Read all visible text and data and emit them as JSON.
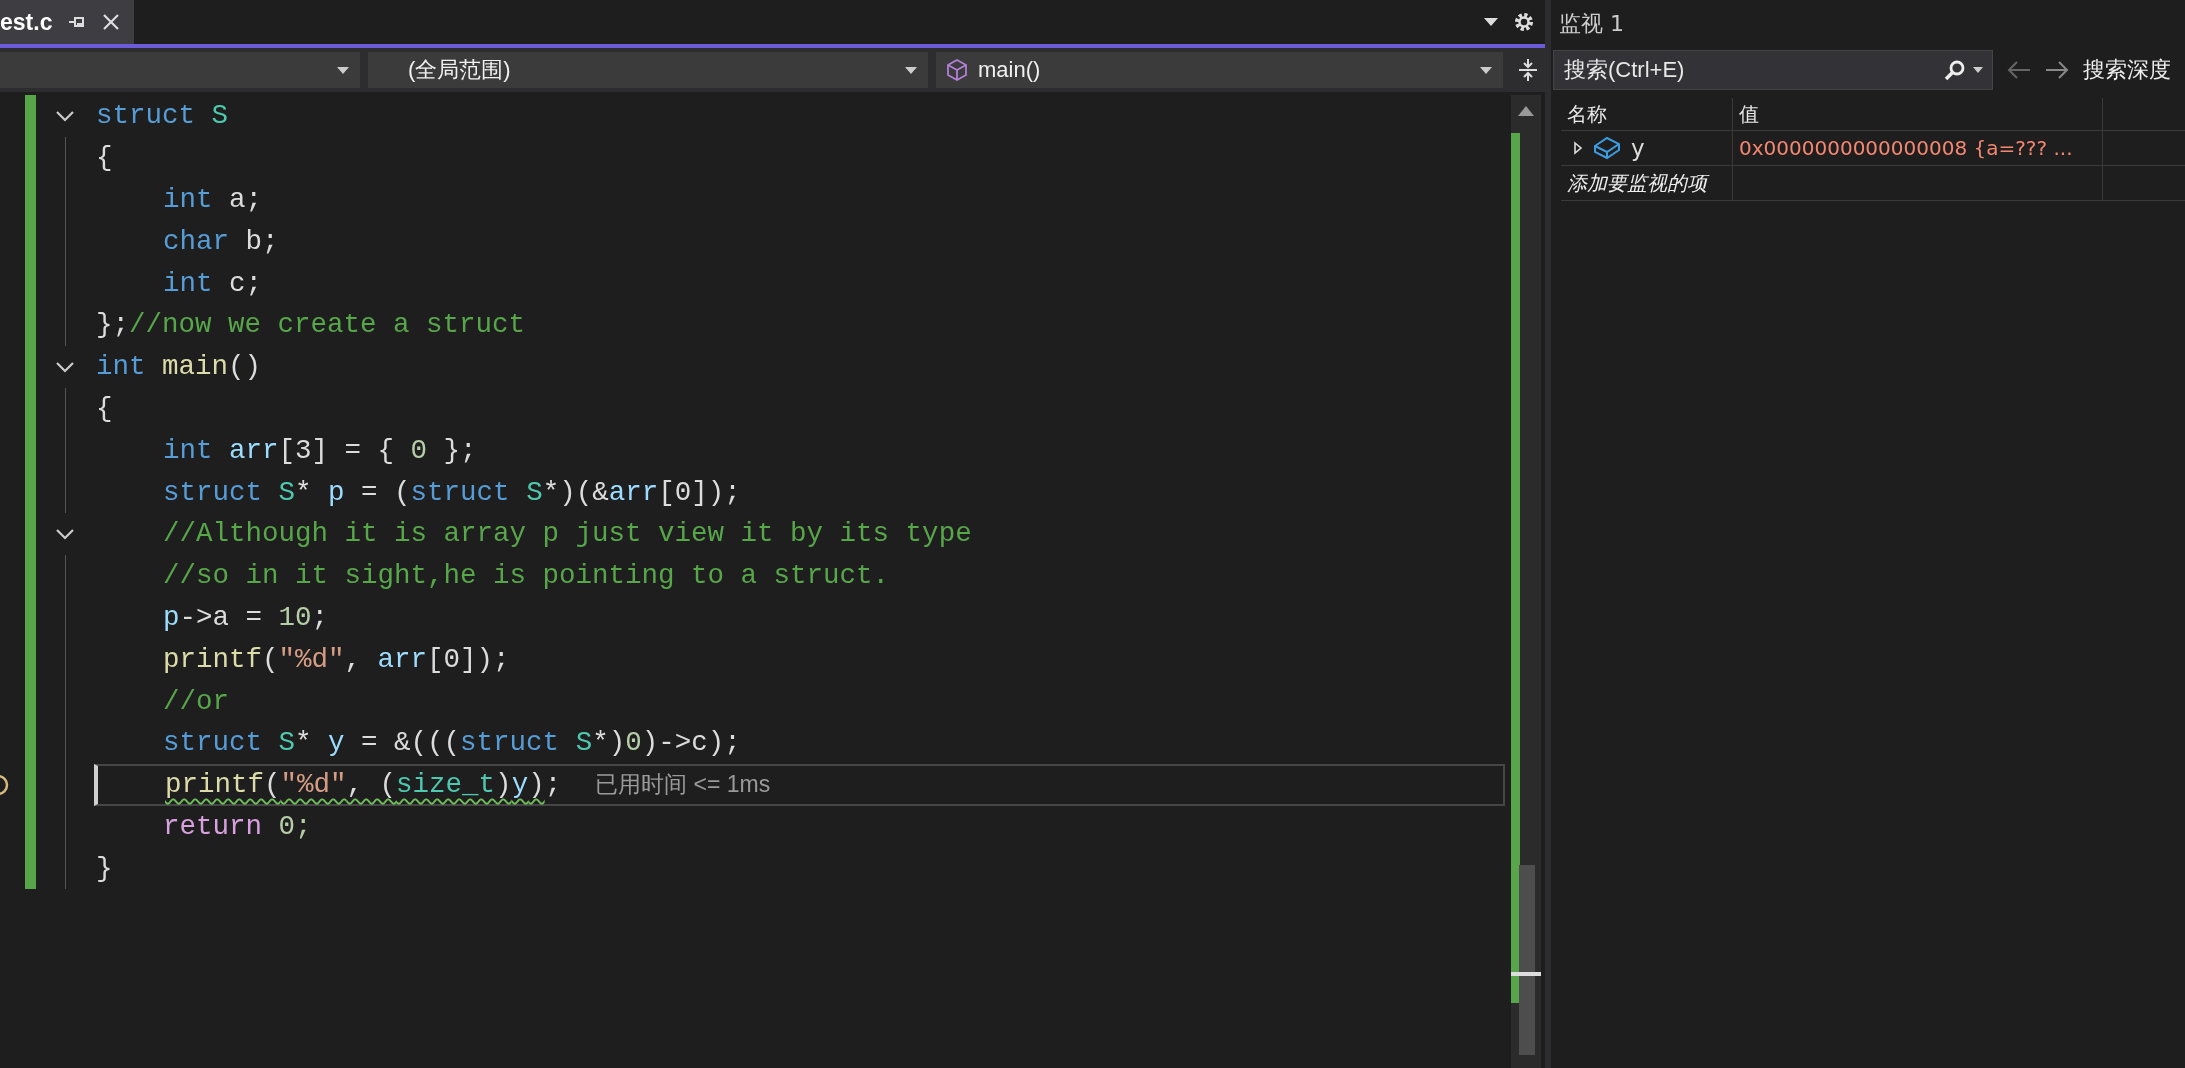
{
  "tab": {
    "title": "est.c"
  },
  "navbar": {
    "scope": "(全局范围)",
    "member": "main()"
  },
  "code_lines": [
    {
      "indented": false,
      "fold": true,
      "tokens": [
        {
          "t": "struct",
          "kind": "keyword"
        },
        {
          "t": " S",
          "kind": "type"
        }
      ]
    },
    {
      "indented": false,
      "fold": false,
      "tokens": [
        {
          "t": "{",
          "kind": "plain"
        }
      ]
    },
    {
      "indented": true,
      "fold": false,
      "tokens": [
        {
          "t": "int",
          "kind": "keyword"
        },
        {
          "t": " a;",
          "kind": "plain"
        }
      ]
    },
    {
      "indented": true,
      "fold": false,
      "tokens": [
        {
          "t": "char",
          "kind": "keyword"
        },
        {
          "t": " b;",
          "kind": "plain"
        }
      ]
    },
    {
      "indented": true,
      "fold": false,
      "tokens": [
        {
          "t": "int",
          "kind": "keyword"
        },
        {
          "t": " c;",
          "kind": "plain"
        }
      ]
    },
    {
      "indented": false,
      "fold": false,
      "tokens": [
        {
          "t": "};",
          "kind": "plain"
        },
        {
          "t": "//now we create a struct",
          "kind": "comment"
        }
      ]
    },
    {
      "indented": false,
      "fold": true,
      "tokens": [
        {
          "t": "int",
          "kind": "keyword"
        },
        {
          "t": " main",
          "kind": "func"
        },
        {
          "t": "()",
          "kind": "plain"
        }
      ]
    },
    {
      "indented": false,
      "fold": false,
      "tokens": [
        {
          "t": "{",
          "kind": "plain"
        }
      ]
    },
    {
      "indented": true,
      "fold": false,
      "tokens": [
        {
          "t": "int",
          "kind": "keyword"
        },
        {
          "t": " arr",
          "kind": "var"
        },
        {
          "t": "[3] = { ",
          "kind": "plain"
        },
        {
          "t": "0",
          "kind": "number"
        },
        {
          "t": " };",
          "kind": "plain"
        }
      ]
    },
    {
      "indented": true,
      "fold": false,
      "tokens": [
        {
          "t": "struct",
          "kind": "keyword"
        },
        {
          "t": " S",
          "kind": "type"
        },
        {
          "t": "* ",
          "kind": "plain"
        },
        {
          "t": "p",
          "kind": "var"
        },
        {
          "t": " = (",
          "kind": "plain"
        },
        {
          "t": "struct",
          "kind": "keyword"
        },
        {
          "t": " S",
          "kind": "type"
        },
        {
          "t": "*)(&",
          "kind": "plain"
        },
        {
          "t": "arr",
          "kind": "var"
        },
        {
          "t": "[0]);",
          "kind": "plain"
        }
      ]
    },
    {
      "indented": true,
      "fold": true,
      "tokens": [
        {
          "t": "//Although it is array p just view it by its type",
          "kind": "comment"
        }
      ]
    },
    {
      "indented": true,
      "fold": false,
      "tokens": [
        {
          "t": "//so in it sight,he is pointing to a struct.",
          "kind": "comment"
        }
      ]
    },
    {
      "indented": true,
      "fold": false,
      "tokens": [
        {
          "t": "p",
          "kind": "var"
        },
        {
          "t": "->a = ",
          "kind": "plain"
        },
        {
          "t": "10",
          "kind": "number"
        },
        {
          "t": ";",
          "kind": "plain"
        }
      ]
    },
    {
      "indented": true,
      "fold": false,
      "tokens": [
        {
          "t": "printf",
          "kind": "func"
        },
        {
          "t": "(",
          "kind": "plain"
        },
        {
          "t": "\"%d\"",
          "kind": "string"
        },
        {
          "t": ", ",
          "kind": "plain"
        },
        {
          "t": "arr",
          "kind": "var"
        },
        {
          "t": "[0]);",
          "kind": "plain"
        }
      ]
    },
    {
      "indented": true,
      "fold": false,
      "tokens": [
        {
          "t": "//or",
          "kind": "comment"
        }
      ]
    },
    {
      "indented": true,
      "fold": false,
      "tokens": [
        {
          "t": "struct",
          "kind": "keyword"
        },
        {
          "t": " S",
          "kind": "type"
        },
        {
          "t": "* ",
          "kind": "plain"
        },
        {
          "t": "y",
          "kind": "var"
        },
        {
          "t": " = &(((",
          "kind": "plain"
        },
        {
          "t": "struct",
          "kind": "keyword"
        },
        {
          "t": " S",
          "kind": "type"
        },
        {
          "t": "*)",
          "kind": "plain"
        },
        {
          "t": "0",
          "kind": "number"
        },
        {
          "t": ")->c);",
          "kind": "plain"
        }
      ]
    },
    {
      "indented": true,
      "fold": false,
      "current": true,
      "tip": true,
      "hint": "已用时间 <= 1ms",
      "tokens": [
        {
          "t": "printf",
          "kind": "func",
          "squiggle": true
        },
        {
          "t": "(",
          "kind": "plain",
          "squiggle": true
        },
        {
          "t": "\"%d\"",
          "kind": "string",
          "squiggle": true
        },
        {
          "t": ", (",
          "kind": "plain",
          "squiggle": true
        },
        {
          "t": "size_t",
          "kind": "type",
          "squiggle": true
        },
        {
          "t": ")",
          "kind": "plain",
          "squiggle": true
        },
        {
          "t": "y",
          "kind": "var",
          "squiggle": true
        },
        {
          "t": ")",
          "kind": "plain",
          "squiggle": true
        },
        {
          "t": ";",
          "kind": "plain"
        }
      ]
    },
    {
      "indented": true,
      "fold": false,
      "tokens": [
        {
          "t": "return",
          "kind": "control"
        },
        {
          "t": " 0;",
          "kind": "number"
        }
      ]
    },
    {
      "indented": false,
      "fold": false,
      "tokens": [
        {
          "t": "}",
          "kind": "plain"
        }
      ]
    }
  ],
  "watch": {
    "title": "监视 1",
    "search": {
      "placeholder": "搜索(Ctrl+E)"
    },
    "depth_label": "搜索深度",
    "columns": [
      "名称",
      "值"
    ],
    "rows": [
      {
        "name": "y",
        "value": "0x0000000000000008 {a=??? ...",
        "expanded": false,
        "error": true
      }
    ],
    "add_row": "添加要监视的项"
  }
}
